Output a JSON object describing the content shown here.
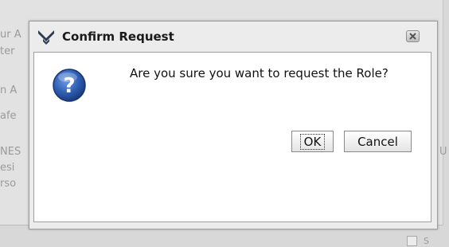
{
  "background": {
    "lines": [
      "ur A",
      "ter",
      "",
      "n A",
      "afe",
      "",
      "NES",
      "esi",
      "rso"
    ],
    "right_text": "U",
    "checkbox_label": "S"
  },
  "dialog": {
    "title": "Confirm Request",
    "title_icon": "chevron-wings-icon",
    "close_icon": "close-icon",
    "message": "Are you sure you want to request the Role?",
    "message_icon": "question-icon",
    "ok_label": "OK",
    "cancel_label": "Cancel"
  },
  "colors": {
    "question_icon": "#2f5fb3",
    "title_icon": "#2f3a52"
  }
}
